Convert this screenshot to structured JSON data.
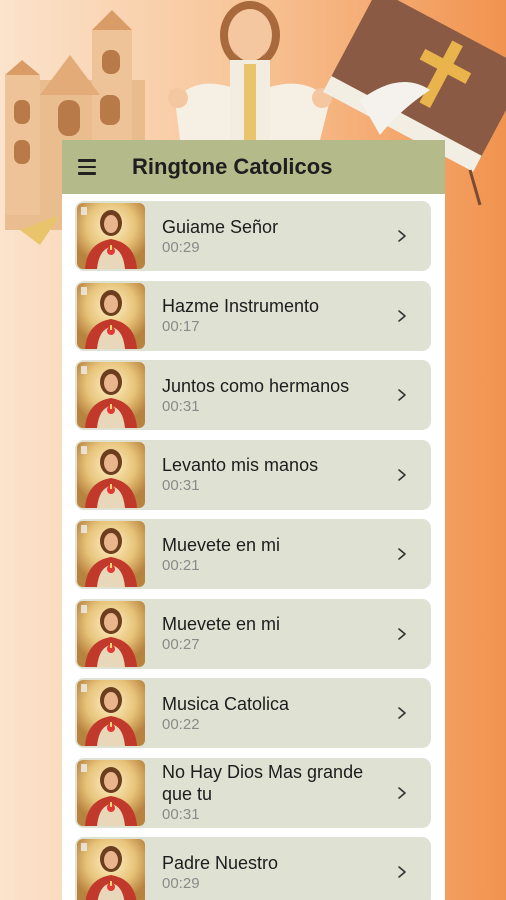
{
  "app": {
    "title": "Ringtone Catolicos"
  },
  "icons": {
    "menu": "menu-icon",
    "chevron": "chevron-right-icon",
    "thumbnail": "sacred-heart-jesus-image"
  },
  "colors": {
    "appbar": "#b4ba8a",
    "item_background": "#dfe2d3",
    "background_start": "#fbe3cc",
    "background_end": "#f1934f"
  },
  "songs": [
    {
      "title": "Guiame Señor",
      "duration": "00:29"
    },
    {
      "title": "Hazme Instrumento",
      "duration": "00:17"
    },
    {
      "title": "Juntos como hermanos",
      "duration": "00:31"
    },
    {
      "title": "Levanto mis manos",
      "duration": "00:31"
    },
    {
      "title": "Muevete en mi",
      "duration": "00:21"
    },
    {
      "title": "Muevete en mi",
      "duration": "00:27"
    },
    {
      "title": "Musica Catolica",
      "duration": "00:22"
    },
    {
      "title": "No Hay Dios Mas grande que tu",
      "duration": "00:31"
    },
    {
      "title": "Padre Nuestro",
      "duration": "00:29"
    }
  ]
}
